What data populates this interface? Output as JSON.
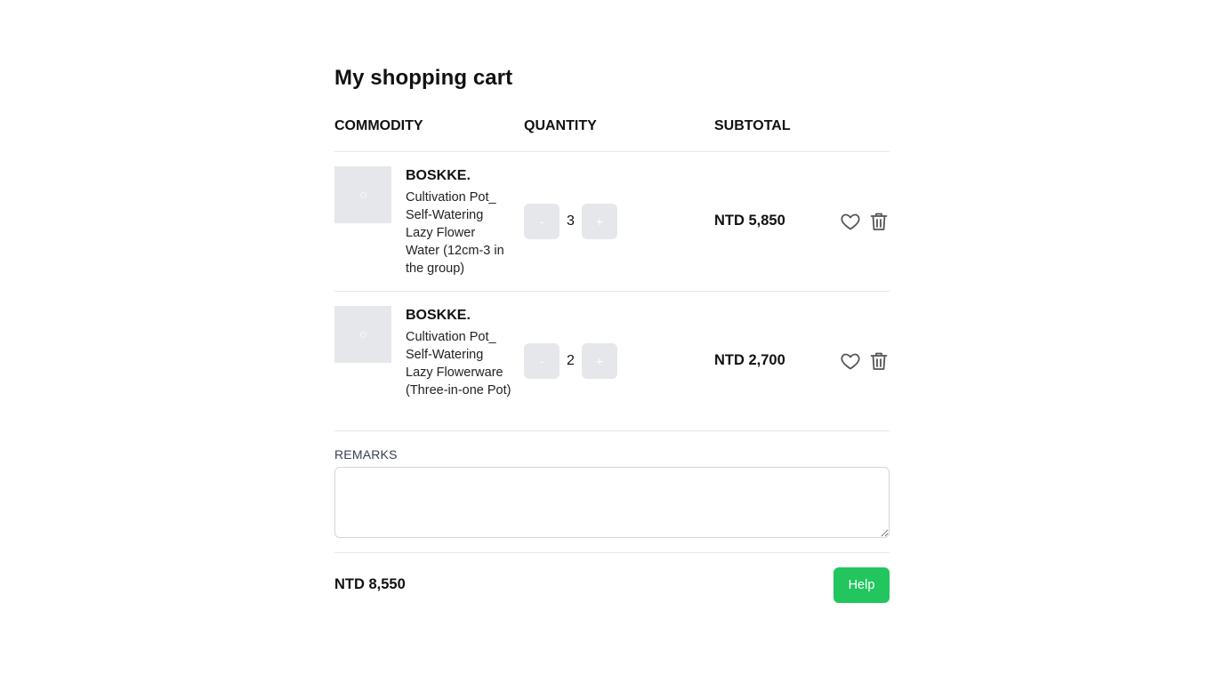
{
  "page": {
    "title": "My shopping cart"
  },
  "table": {
    "headers": {
      "commodity": "COMMODITY",
      "quantity": "QUANTITY",
      "subtotal": "SUBTOTAL"
    }
  },
  "items": [
    {
      "brand": "BOSKKE.",
      "name": "Cultivation Pot_ Self-Watering Lazy Flower Water (12cm-3 in the group)",
      "decrement_label": "-",
      "quantity": "3",
      "increment_label": "+",
      "subtotal": "NTD 5,850"
    },
    {
      "brand": "BOSKKE.",
      "name": "Cultivation Pot_ Self-Watering Lazy Flowerware (Three-in-one Pot)",
      "decrement_label": "-",
      "quantity": "2",
      "increment_label": "+",
      "subtotal": "NTD 2,700"
    }
  ],
  "remarks": {
    "label": "REMARKS",
    "value": ""
  },
  "footer": {
    "total": "NTD 8,550",
    "help_label": "Help"
  },
  "icons": {
    "favorite": "heart-icon",
    "delete": "trash-icon",
    "thumbnail": "image-placeholder-icon"
  },
  "colors": {
    "accent": "#22c55e",
    "button_bg": "#e5e7eb",
    "divider": "#e5e7eb"
  }
}
